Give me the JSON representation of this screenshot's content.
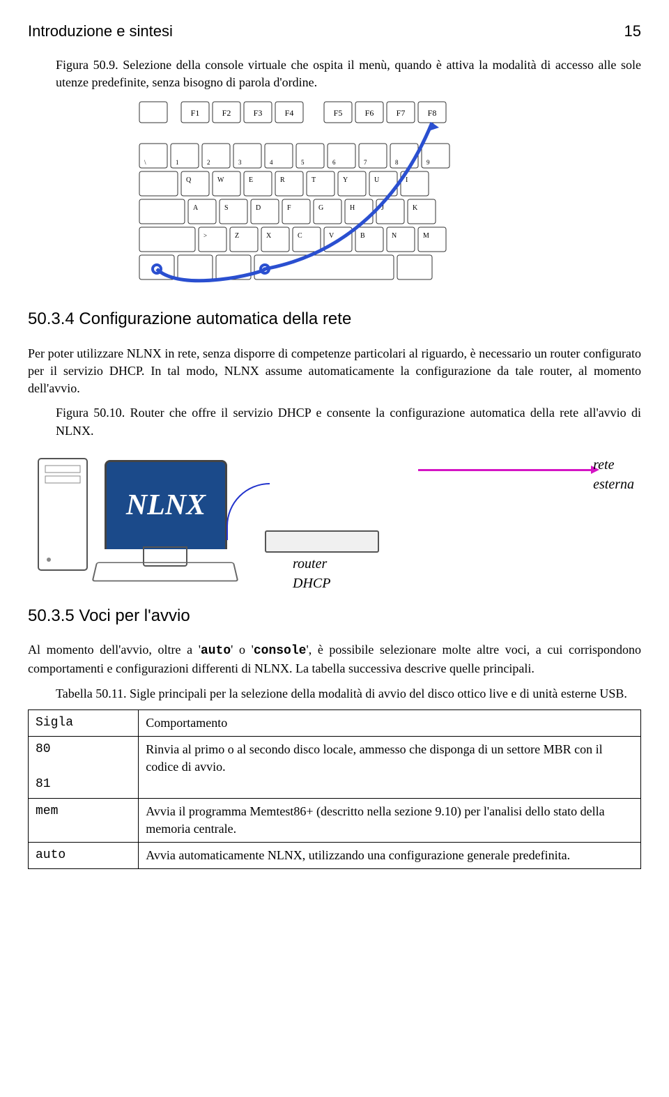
{
  "header": {
    "left": "Introduzione e sintesi",
    "right": "15"
  },
  "fig1_caption": "Figura 50.9. Selezione della console virtuale che ospita il menù, quando è attiva la modalità di accesso alle sole utenze predefinite, senza bisogno di parola d'ordine.",
  "sec1_title": "50.3.4 Configurazione automatica della rete",
  "sec1_p1": "Per poter utilizzare NLNX in rete, senza disporre di competenze particolari al riguardo, è necessario un router configurato per il servizio DHCP. In tal modo, NLNX assume automaticamente la configurazione da tale router, al momento dell'avvio.",
  "fig2_caption": "Figura 50.10. Router che offre il servizio DHCP e consente la configurazione automatica della rete all'avvio di NLNX.",
  "diagram": {
    "screen": "NLNX",
    "router": "router\nDHCP",
    "ext": "rete\nesterna"
  },
  "sec2_title": "50.3.5 Voci per l'avvio",
  "sec2_p1a": "Al momento dell'avvio, oltre a '",
  "sec2_p1b": "' o '",
  "sec2_p1c": "', è possibile selezionare molte altre voci, a cui corrispondono comportamenti e configurazioni differenti di NLNX. La tabella successiva descrive quelle principali.",
  "code1": "auto",
  "code2": "console",
  "tab_caption": "Tabella 50.11. Sigle principali per la selezione della modalità di avvio del disco ottico live e di unità esterne USB.",
  "table": {
    "h1": "Sigla",
    "h2": "Comportamento",
    "r1a": "80",
    "r1b": "81",
    "r1t": "Rinvia al primo o al secondo disco locale, ammesso che disponga di un settore MBR con il codice di avvio.",
    "r2a": "mem",
    "r2t": "Avvia il programma Memtest86+ (descritto nella sezione 9.10) per l'analisi dello stato della memoria centrale.",
    "r3a": "auto",
    "r3t": "Avvia automaticamente NLNX, utilizzando una configurazione generale predefinita."
  },
  "fkeys": [
    "F1",
    "F2",
    "F3",
    "F4",
    "F5",
    "F6",
    "F7",
    "F8"
  ]
}
